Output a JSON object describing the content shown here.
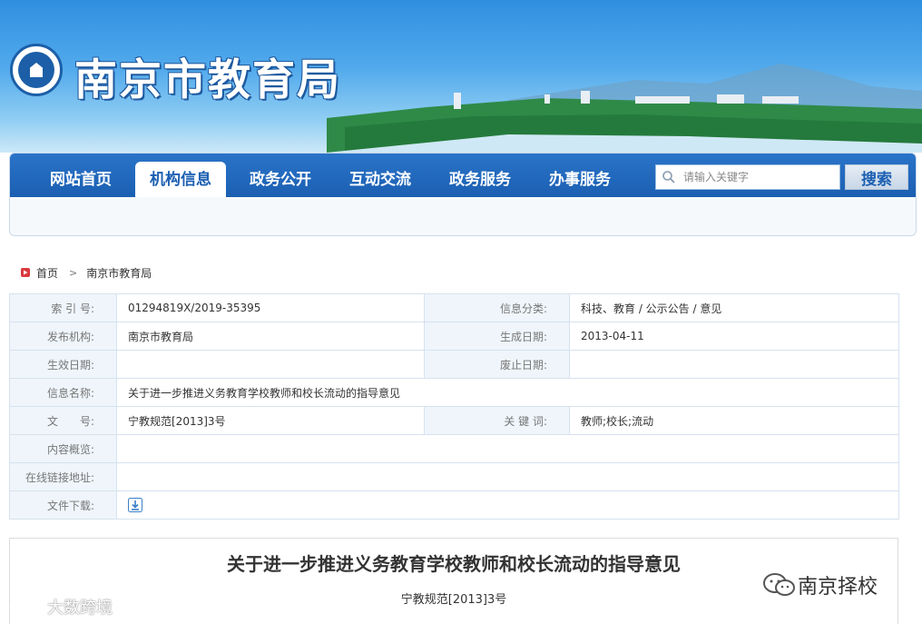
{
  "header": {
    "site_title": "南京市教育局",
    "logo_icon": "nanjing-education-seal-icon",
    "colors": {
      "brand_blue": "#1b5fb2",
      "banner_sky": "#52aaec"
    }
  },
  "nav": {
    "items": [
      {
        "label": "网站首页",
        "active": false
      },
      {
        "label": "机构信息",
        "active": true
      },
      {
        "label": "政务公开",
        "active": false
      },
      {
        "label": "互动交流",
        "active": false
      },
      {
        "label": "政务服务",
        "active": false
      },
      {
        "label": "办事服务",
        "active": false
      }
    ],
    "search": {
      "placeholder": "请输入关键字",
      "value": "",
      "button_label": "搜索",
      "icon": "search-icon"
    }
  },
  "breadcrumb": {
    "items": [
      "首页",
      "南京市教育局"
    ],
    "home_icon": "home-icon"
  },
  "info": {
    "index_no_label": "索 引 号:",
    "index_no_value": "01294819X/2019-35395",
    "category_label": "信息分类:",
    "category_value": "科技、教育 / 公示公告 / 意见",
    "publisher_label": "发布机构:",
    "publisher_value": "南京市教育局",
    "created_label": "生成日期:",
    "created_value": "2013-04-11",
    "effective_label": "生效日期:",
    "effective_value": "",
    "expiry_label": "废止日期:",
    "expiry_value": "",
    "name_label": "信息名称:",
    "name_value": "关于进一步推进义务教育学校教师和校长流动的指导意见",
    "docno_label": "文　　号:",
    "docno_value": "宁教规范[2013]3号",
    "keywords_label": "关 键 词:",
    "keywords_value": "教师;校长;流动",
    "summary_label": "内容概览:",
    "summary_value": "",
    "link_label": "在线链接地址:",
    "link_value": "",
    "download_label": "文件下载:",
    "download_icon": "download-icon"
  },
  "document": {
    "title": "关于进一步推进义务教育学校教师和校长流动的指导意见",
    "number": "宁教规范[2013]3号"
  },
  "watermarks": {
    "left_text": "大数跨境",
    "right_text": "南京择校"
  }
}
